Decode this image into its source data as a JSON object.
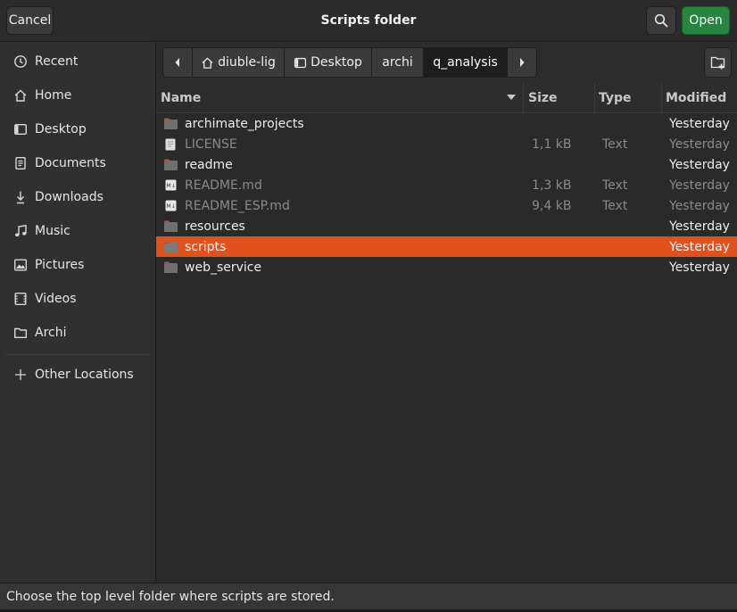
{
  "header": {
    "cancel_label": "Cancel",
    "title": "Scripts folder",
    "open_label": "Open",
    "colors": {
      "open_button": "#26853f",
      "selection": "#e2501c"
    }
  },
  "sidebar": {
    "items": [
      {
        "label": "Recent",
        "icon": "clock-icon"
      },
      {
        "label": "Home",
        "icon": "home-icon"
      },
      {
        "label": "Desktop",
        "icon": "desktop-icon"
      },
      {
        "label": "Documents",
        "icon": "document-icon"
      },
      {
        "label": "Downloads",
        "icon": "download-icon"
      },
      {
        "label": "Music",
        "icon": "music-icon"
      },
      {
        "label": "Pictures",
        "icon": "pictures-icon"
      },
      {
        "label": "Videos",
        "icon": "video-icon"
      },
      {
        "label": "Archi",
        "icon": "folder-icon"
      }
    ],
    "other_locations_label": "Other Locations"
  },
  "pathbar": {
    "crumbs": [
      "diuble-lig",
      "Desktop",
      "archi",
      "q_analysis"
    ],
    "active_index": 3
  },
  "columns": {
    "name": "Name",
    "size": "Size",
    "type": "Type",
    "modified": "Modified"
  },
  "files": [
    {
      "name": "archimate_projects",
      "size": "",
      "type": "",
      "modified": "Yesterday",
      "kind": "folder"
    },
    {
      "name": "LICENSE",
      "size": "1,1 kB",
      "type": "Text",
      "modified": "Yesterday",
      "kind": "text"
    },
    {
      "name": "readme",
      "size": "",
      "type": "",
      "modified": "Yesterday",
      "kind": "folder"
    },
    {
      "name": "README.md",
      "size": "1,3 kB",
      "type": "Text",
      "modified": "Yesterday",
      "kind": "markdown"
    },
    {
      "name": "README_ESP.md",
      "size": "9,4 kB",
      "type": "Text",
      "modified": "Yesterday",
      "kind": "markdown"
    },
    {
      "name": "resources",
      "size": "",
      "type": "",
      "modified": "Yesterday",
      "kind": "folder"
    },
    {
      "name": "scripts",
      "size": "",
      "type": "",
      "modified": "Yesterday",
      "kind": "folder",
      "selected": true
    },
    {
      "name": "web_service",
      "size": "",
      "type": "",
      "modified": "Yesterday",
      "kind": "folder"
    }
  ],
  "status": {
    "text": "Choose the top level folder where scripts are stored."
  }
}
